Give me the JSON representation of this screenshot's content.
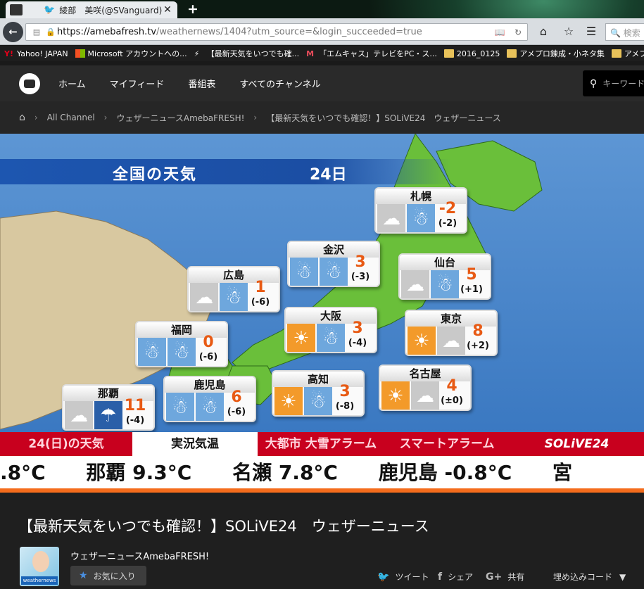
{
  "browser": {
    "tab_title": "綾部　美咲(@SVanguard)...",
    "tab_close": "✕",
    "new_tab": "+",
    "url_host": "https://amebafresh.tv",
    "url_path": "/weathernews/1404?utm_source=&login_succeeded=true",
    "search_placeholder": "検索"
  },
  "bookmarks": [
    {
      "label": "Yahoo! JAPAN",
      "icon": "yahoo-icon"
    },
    {
      "label": "Microsoft アカウントへの...",
      "icon": "microsoft-icon"
    },
    {
      "label": "【最新天気をいつでも確...",
      "icon": "flash-icon"
    },
    {
      "label": "「エムキャス」テレビをPC・ス...",
      "icon": "mcas-icon"
    },
    {
      "label": "2016_0125",
      "icon": "folder-icon"
    },
    {
      "label": "アメプロ錬成・小ネタ集",
      "icon": "folder-icon"
    },
    {
      "label": "アメプロカスタマイズ関連",
      "icon": "folder-icon"
    }
  ],
  "site": {
    "nav": [
      "ホーム",
      "マイフィード",
      "番組表",
      "すべてのチャンネル"
    ],
    "search_placeholder": "キーワード"
  },
  "breadcrumb": [
    "All Channel",
    "ウェザーニュースAmebaFRESH!",
    "【最新天気をいつでも確認！】SOLiVE24　ウェザーニュース"
  ],
  "video": {
    "header_title": "全国の天気",
    "header_date": "24日",
    "cities": [
      {
        "name": "札幌",
        "temp": "-2",
        "diff": "(-2)",
        "w1": "cloud",
        "w2": "snow"
      },
      {
        "name": "金沢",
        "temp": "3",
        "diff": "(-3)",
        "w1": "snow",
        "w2": "snow"
      },
      {
        "name": "広島",
        "temp": "1",
        "diff": "(-6)",
        "w1": "cloud",
        "w2": "snow"
      },
      {
        "name": "仙台",
        "temp": "5",
        "diff": "(+1)",
        "w1": "cloud",
        "w2": "snow"
      },
      {
        "name": "大阪",
        "temp": "3",
        "diff": "(-4)",
        "w1": "sun",
        "w2": "snow"
      },
      {
        "name": "福岡",
        "temp": "0",
        "diff": "(-6)",
        "w1": "snow",
        "w2": "snow"
      },
      {
        "name": "東京",
        "temp": "8",
        "diff": "(+2)",
        "w1": "sun",
        "w2": "cloud"
      },
      {
        "name": "鹿児島",
        "temp": "6",
        "diff": "(-6)",
        "w1": "snow",
        "w2": "snow"
      },
      {
        "name": "高知",
        "temp": "3",
        "diff": "(-8)",
        "w1": "sun",
        "w2": "snow"
      },
      {
        "name": "名古屋",
        "temp": "4",
        "diff": "(±0)",
        "w1": "sun",
        "w2": "cloud"
      },
      {
        "name": "那覇",
        "temp": "11",
        "diff": "(-4)",
        "w1": "cloud",
        "w2": "rain"
      }
    ],
    "tabs": [
      "24(日)の天気",
      "実況気温",
      "大都市 大雪アラーム",
      "スマートアラーム",
      "SOLiVE24"
    ],
    "ticker": [
      ".8°C",
      "那覇  9.3°C",
      "名瀬  7.8°C",
      "鹿児島  -0.8°C",
      "宮"
    ]
  },
  "page": {
    "title": "【最新天気をいつでも確認！】SOLiVE24　ウェザーニュース",
    "channel_name": "ウェザーニュースAmebaFRESH!",
    "channel_thumb_label": "weathernews",
    "favorite": "お気に入り",
    "tweet": "ツイート",
    "share_fb": "シェア",
    "share_gplus": "共有",
    "embed": "埋め込みコード"
  },
  "colors": {
    "accent": "#c8001e",
    "temp": "#e85a14",
    "sea": "#3a78c1",
    "land": "#6abf3a"
  }
}
